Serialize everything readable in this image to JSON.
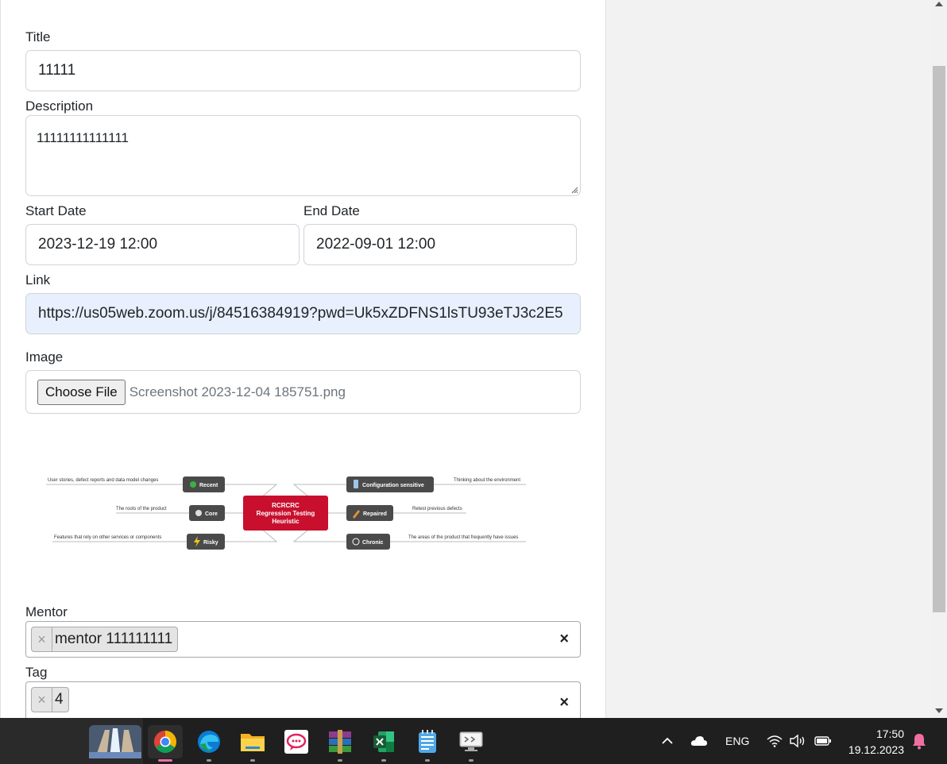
{
  "form": {
    "title_label": "Title",
    "title_value": "11111",
    "description_label": "Description",
    "description_value": "11111111111111",
    "start_date_label": "Start Date",
    "start_date_value": "2023-12-19 12:00",
    "end_date_label": "End Date",
    "end_date_value": "2022-09-01 12:00",
    "link_label": "Link",
    "link_value": "https://us05web.zoom.us/j/84516384919?pwd=Uk5xZDFNS1lsTU93eTJ3c2E5",
    "image_label": "Image",
    "choose_file_label": "Choose File",
    "file_name": "Screenshot 2023-12-04 185751.png",
    "mentor_label": "Mentor",
    "mentor_chip": "mentor 111111111",
    "tag_label": "Tag",
    "tag_chip": "4",
    "chip_remove_symbol": "×",
    "clear_symbol": "×"
  },
  "mindmap": {
    "center_line1": "RCRCRC",
    "center_line2": "Regression Testing",
    "center_line3": "Heuristic",
    "center_color": "#c8102e",
    "node_color": "#4a4a4a",
    "left_nodes": [
      {
        "label": "Recent",
        "note": "User stories, defect reports and data model changes",
        "icon": "minus-circle-icon"
      },
      {
        "label": "Core",
        "note": "The roots of the product",
        "icon": "gear-icon"
      },
      {
        "label": "Risky",
        "note": "Features that rely on other services or components",
        "icon": "lightning-icon"
      }
    ],
    "right_nodes": [
      {
        "label": "Configuration sensitive",
        "note": "Thinking about the environment",
        "icon": "device-icon"
      },
      {
        "label": "Repaired",
        "note": "Retest previous defects",
        "icon": "wrench-icon"
      },
      {
        "label": "Chronic",
        "note": "The areas of the product that frequently have issues",
        "icon": "clock-icon"
      }
    ]
  },
  "taskbar": {
    "apps": [
      {
        "name": "chrome-icon",
        "active": true
      },
      {
        "name": "edge-icon",
        "active": false
      },
      {
        "name": "file-explorer-icon",
        "active": false
      },
      {
        "name": "chat-app-icon",
        "active": false
      },
      {
        "name": "winrar-icon",
        "active": false
      },
      {
        "name": "excel-icon",
        "active": false
      },
      {
        "name": "notepad-icon",
        "active": false
      },
      {
        "name": "remote-desktop-icon",
        "active": false
      }
    ],
    "language": "ENG",
    "time": "17:50",
    "date": "19.12.2023"
  }
}
